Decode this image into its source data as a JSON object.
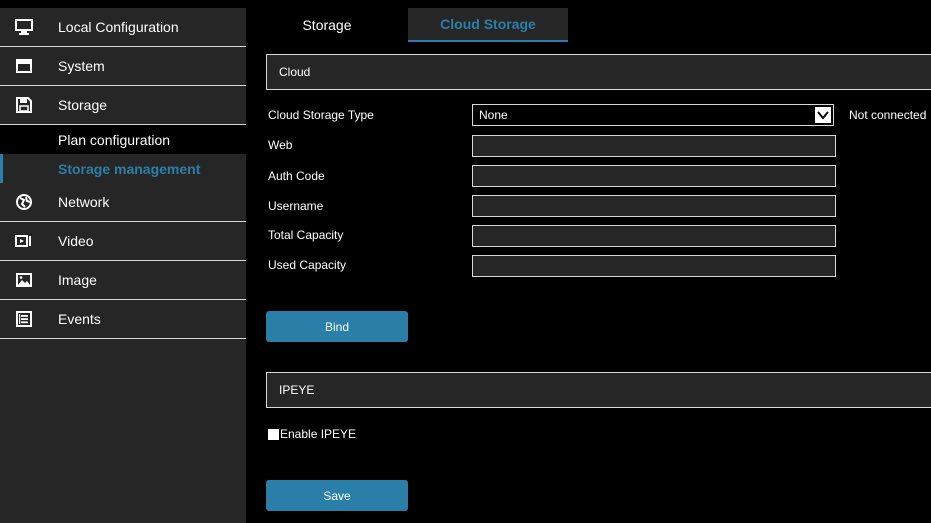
{
  "sidebar": {
    "items": [
      {
        "label": "Local Configuration",
        "icon": "monitor-icon"
      },
      {
        "label": "System",
        "icon": "system-icon"
      },
      {
        "label": "Storage",
        "icon": "storage-icon"
      },
      {
        "label": "Network",
        "icon": "network-icon"
      },
      {
        "label": "Video",
        "icon": "video-icon"
      },
      {
        "label": "Image",
        "icon": "image-icon"
      },
      {
        "label": "Events",
        "icon": "events-icon"
      }
    ],
    "submenu": [
      {
        "label": "Plan configuration"
      },
      {
        "label": "Storage management"
      }
    ]
  },
  "tabs": [
    {
      "label": "Storage"
    },
    {
      "label": "Cloud Storage"
    }
  ],
  "cloud": {
    "header": "Cloud",
    "type_label": "Cloud Storage Type",
    "type_value": "None",
    "status": "Not connected",
    "web_label": "Web",
    "auth_label": "Auth Code",
    "username_label": "Username",
    "total_label": "Total Capacity",
    "used_label": "Used Capacity",
    "bind_label": "Bind"
  },
  "ipeye": {
    "header": "IPEYE",
    "enable_label": "Enable IPEYE",
    "enabled": false,
    "save_label": "Save"
  },
  "colors": {
    "accent": "#2a7fa8",
    "panel": "#262626",
    "background": "#000000",
    "border": "#d8d8d8"
  }
}
